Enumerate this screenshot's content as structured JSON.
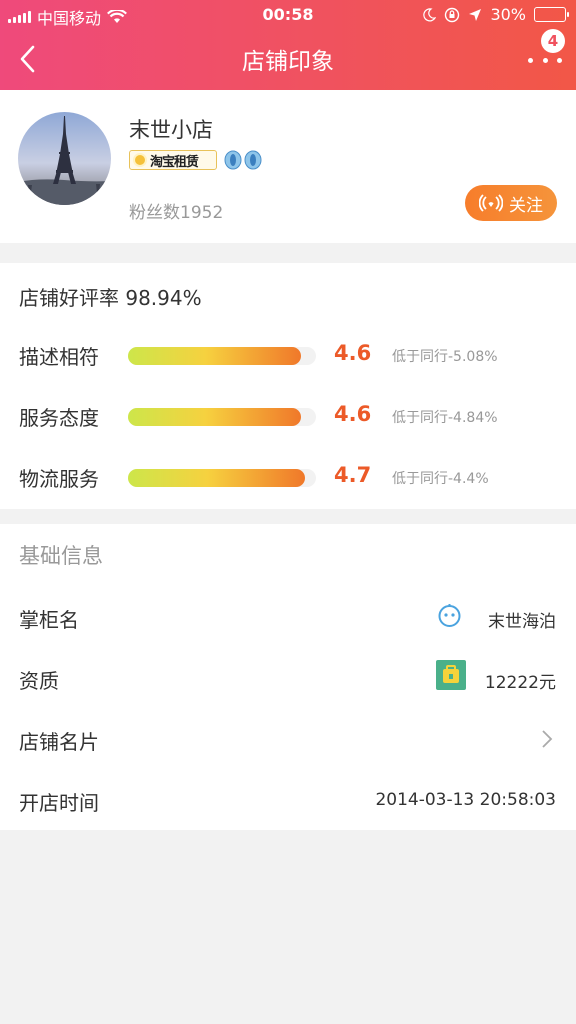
{
  "status_bar": {
    "carrier": "中国移动",
    "time": "00:58",
    "battery": "30%"
  },
  "nav": {
    "title": "店铺印象",
    "badge_count": "4"
  },
  "shop": {
    "name": "末世小店",
    "badge_label": "淘宝租赁",
    "fans": "粉丝数1952",
    "follow_label": "关注"
  },
  "ratings": {
    "good_rate_label": "店铺好评率",
    "good_rate_value": "98.94%",
    "items": [
      {
        "label": "描述相符",
        "score": "4.6",
        "fill": 0.92,
        "compare": "低于同行-5.08%"
      },
      {
        "label": "服务态度",
        "score": "4.6",
        "fill": 0.92,
        "compare": "低于同行-4.84%"
      },
      {
        "label": "物流服务",
        "score": "4.7",
        "fill": 0.94,
        "compare": "低于同行-4.4%"
      }
    ]
  },
  "basic_info": {
    "title": "基础信息",
    "rows": [
      {
        "label": "掌柜名",
        "value": "末世海泊",
        "icon": "smiley-icon"
      },
      {
        "label": "资质",
        "value": "12222元",
        "icon": "deposit-icon"
      },
      {
        "label": "店铺名片",
        "value": "",
        "icon": "chevron-right-icon"
      },
      {
        "label": "开店时间",
        "value": "2014-03-13 20:58:03"
      }
    ]
  },
  "colors": {
    "header_start": "#ef4a7b",
    "header_end": "#f25747",
    "accent_orange": "#ec5a28",
    "follow_button": "#f77d2b"
  }
}
